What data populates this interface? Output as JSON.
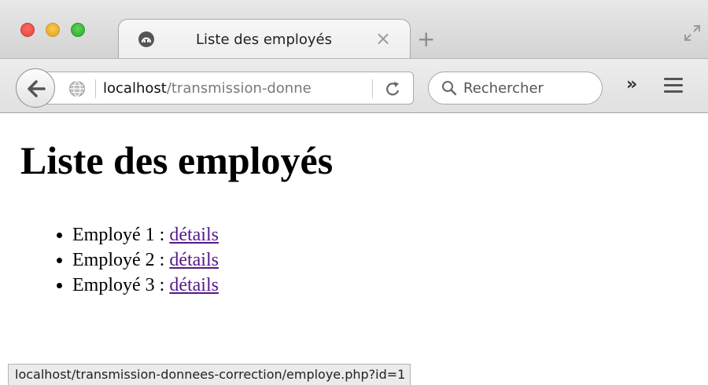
{
  "window": {
    "tab": {
      "title": "Liste des employés",
      "close_glyph": "×"
    },
    "new_tab_glyph": "+"
  },
  "toolbar": {
    "url_host": "localhost",
    "url_path": "/transmission-donne",
    "search_placeholder": "Rechercher",
    "overflow_glyph": "»"
  },
  "page": {
    "title": "Liste des employés",
    "employees": [
      {
        "label": "Employé 1 : ",
        "link": "détails"
      },
      {
        "label": "Employé 2 : ",
        "link": "détails"
      },
      {
        "label": "Employé 3 : ",
        "link": "détails"
      }
    ]
  },
  "status_bar": {
    "url": "localhost/transmission-donnees-correction/employe.php?id=1"
  },
  "icons": [
    "tab-favicon-icon",
    "fullscreen-icon",
    "back-arrow-icon",
    "site-globe-icon",
    "reload-icon",
    "search-icon",
    "hamburger-menu-icon"
  ],
  "colors": {
    "visited_link": "#551a8b",
    "close": "#ff5f57",
    "minimize": "#febc2e",
    "maximize": "#28c840"
  }
}
